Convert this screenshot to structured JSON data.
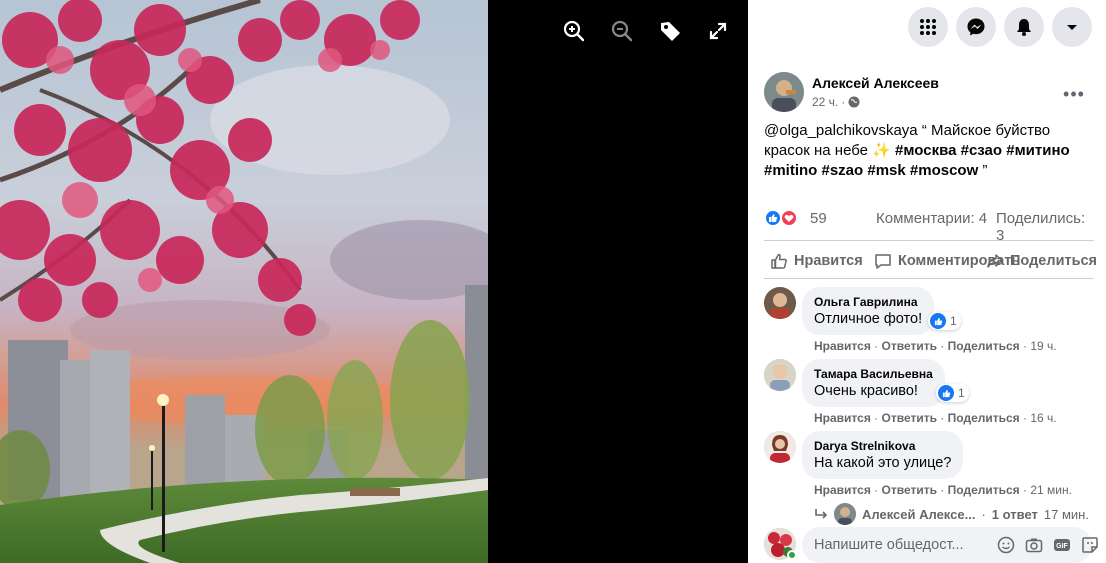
{
  "viewer": {
    "tools": [
      {
        "name": "zoom-in-icon"
      },
      {
        "name": "zoom-out-icon"
      },
      {
        "name": "tag-icon"
      },
      {
        "name": "fullscreen-icon"
      }
    ]
  },
  "topbar": {
    "buttons": [
      "menu-grid-icon",
      "messenger-icon",
      "notifications-bell-icon",
      "account-caret-icon"
    ]
  },
  "post": {
    "author": "Алексей Алексеев",
    "time": "22 ч.",
    "separator": "·",
    "text_mention": "@olga_palchikovskaya",
    "text_quote": " “ Майское буйство красок на небе ",
    "text_sparkle": "✨",
    "text_tags": " #москва #сзао #митино #mitino #szao #msk #moscow",
    "text_end": " ”",
    "reaction_count": "59",
    "comments_label": "Комментарии: 4",
    "shares_label": "Поделились: 3",
    "more_label": "•••"
  },
  "actions": {
    "like": "Нравится",
    "comment": "Комментировать",
    "share": "Поделиться"
  },
  "comments": [
    {
      "author": "Ольга Гаврилина",
      "text": "Отличное фото!",
      "likes": "1",
      "like": "Нравится",
      "reply": "Ответить",
      "share": "Поделиться",
      "time": "19 ч.",
      "sep": "·"
    },
    {
      "author": "Тамара Васильевна",
      "text": "Очень красиво!",
      "likes": "1",
      "like": "Нравится",
      "reply": "Ответить",
      "share": "Поделиться",
      "time": "16 ч.",
      "sep": "·"
    },
    {
      "author": "Darya Strelnikova",
      "text": "На какой это улице?",
      "like": "Нравится",
      "reply": "Ответить",
      "share": "Поделиться",
      "time": "21 мин.",
      "sep": "·"
    }
  ],
  "reply_thread": {
    "author": "Алексей Алексе...",
    "count": "1 ответ",
    "time": "17 мин.",
    "sep": "·"
  },
  "composer": {
    "placeholder": "Напишите общедост..."
  },
  "colors": {
    "accent": "#1877f2",
    "love": "#f33e58",
    "online": "#31a24c"
  }
}
